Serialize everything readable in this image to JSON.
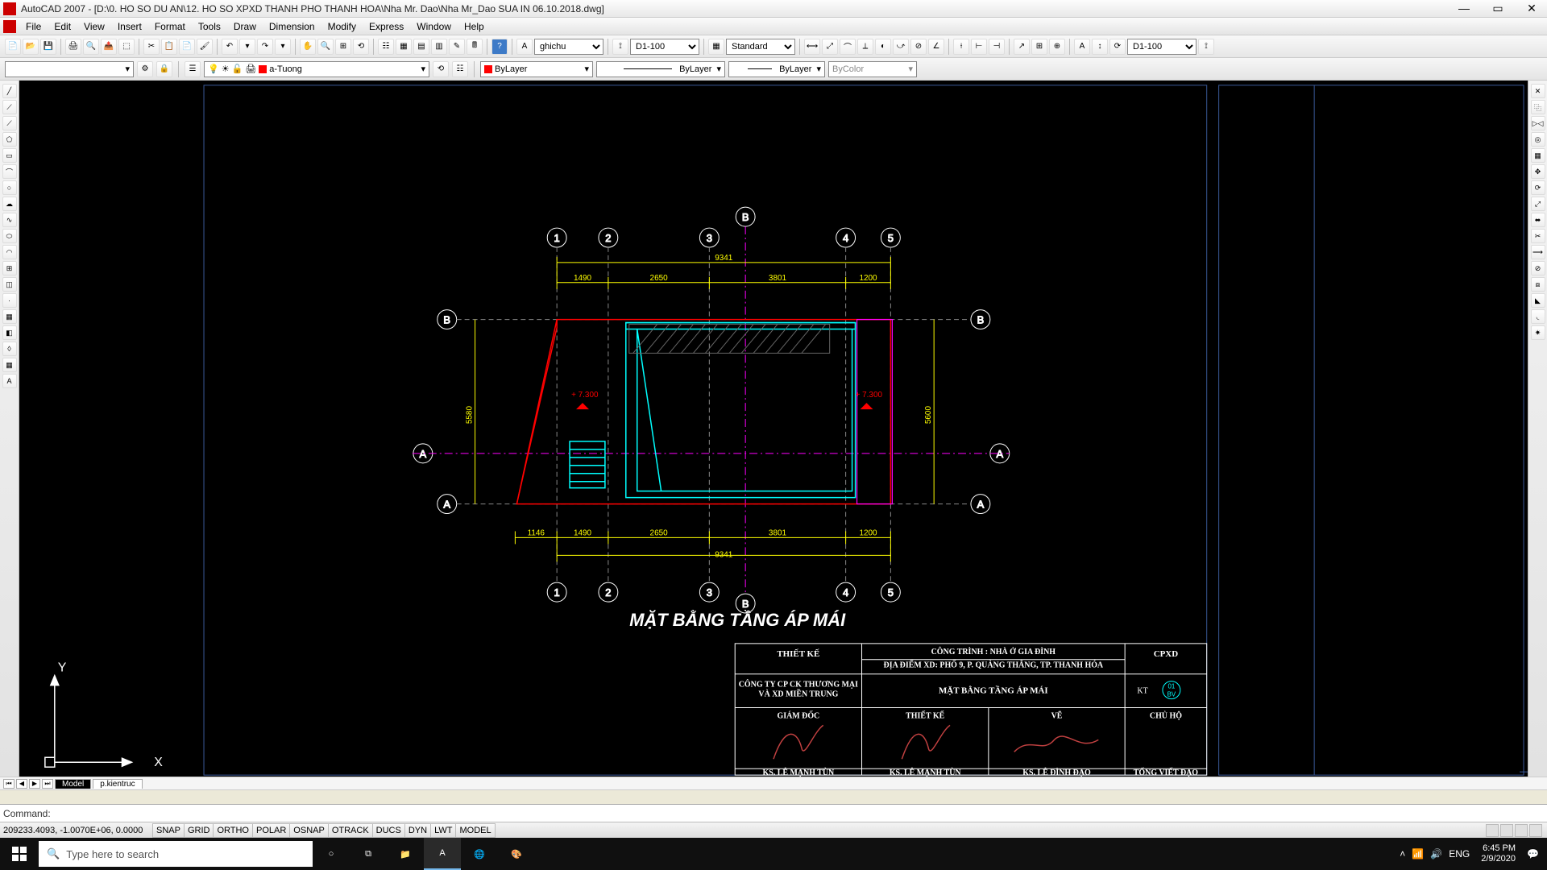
{
  "app": {
    "title": "AutoCAD 2007 - [D:\\0. HO SO DU AN\\12. HO SO XPXD THANH PHO THANH HOA\\Nha Mr. Dao\\Nha Mr_Dao SUA IN 06.10.2018.dwg]"
  },
  "menu": [
    "File",
    "Edit",
    "View",
    "Insert",
    "Format",
    "Tools",
    "Draw",
    "Dimension",
    "Modify",
    "Express",
    "Window",
    "Help"
  ],
  "toolbar2": {
    "textstyle": "ghichu",
    "dimstyle1": "D1-100",
    "tablestyle": "Standard",
    "dimstyle2": "D1-100"
  },
  "layer": {
    "current": "a-Tuong",
    "color_prop": "ByLayer",
    "ltype_prop": "ByLayer",
    "lweight_prop": "ByLayer",
    "plotstyle": "ByColor"
  },
  "tabs": {
    "model": "Model",
    "layout1": "p.kientruc"
  },
  "command": {
    "prompt": "Command:"
  },
  "status": {
    "coords": "209233.4093, -1.0070E+06, 0.0000",
    "toggles": [
      "SNAP",
      "GRID",
      "ORTHO",
      "POLAR",
      "OSNAP",
      "OTRACK",
      "DUCS",
      "DYN",
      "LWT",
      "MODEL"
    ]
  },
  "taskbar": {
    "search_placeholder": "Type here to search",
    "time": "6:45 PM",
    "date": "2/9/2020",
    "lang": "ENG"
  },
  "drawing": {
    "title": "MẶT BẰNG TẦNG ÁP MÁI",
    "grids_top": [
      "1",
      "2",
      "3",
      "4",
      "5"
    ],
    "grid_B_top": "B",
    "grid_B_mid_left": "B",
    "grid_B_mid_right": "B",
    "grid_A_mid_left": "A",
    "grid_A_mid_right": "A",
    "grid_A_bot_left": "A",
    "grid_A_bot_right": "A",
    "grid_B_bot": "B",
    "dims_top": {
      "d1": "1490",
      "d2": "2650",
      "d3": "3801",
      "d4": "1200",
      "total": "9341"
    },
    "dims_bot": {
      "d0": "1146",
      "d1": "1490",
      "d2": "2650",
      "d3": "3801",
      "d4": "1200",
      "total": "9341"
    },
    "dims_left_v": "5580",
    "dims_right_v": "5600",
    "elev_left": "+ 7.300",
    "elev_right": "+ 7.300"
  },
  "titleblock": {
    "col1_h1": "THIẾT KẾ",
    "col1_h2a": "CÔNG TY CP CK THƯƠNG MẠI",
    "col1_h2b": "VÀ XD MIỀN TRUNG",
    "col1_h3": "GIÁM ĐỐC",
    "col1_sig": "KS. LÊ MẠNH TÙN",
    "col2_h1a": "CÔNG TRÌNH : NHÀ Ở GIA ĐÌNH",
    "col2_h1b": "ĐỊA ĐIỂM XD:  PHỐ 9, P. QUẢNG THẮNG, TP. THANH HÓA",
    "col2_h2": "MẶT BẰNG TẦNG ÁP MÁI",
    "col2_h3a": "THIẾT KẾ",
    "col2_h3b": "VẼ",
    "col2_sig_a": "KS. LÊ MẠNH TÙN",
    "col2_sig_b": "KS. LÊ ĐÌNH ĐẠO",
    "col3_h1": "CPXD",
    "col3_h2": "KT",
    "col3_h2_num": "01",
    "col3_h2_bv": "BV",
    "col3_h3": "CHỦ HỘ",
    "col3_sig": "TỐNG VIẾT ĐẠO"
  }
}
